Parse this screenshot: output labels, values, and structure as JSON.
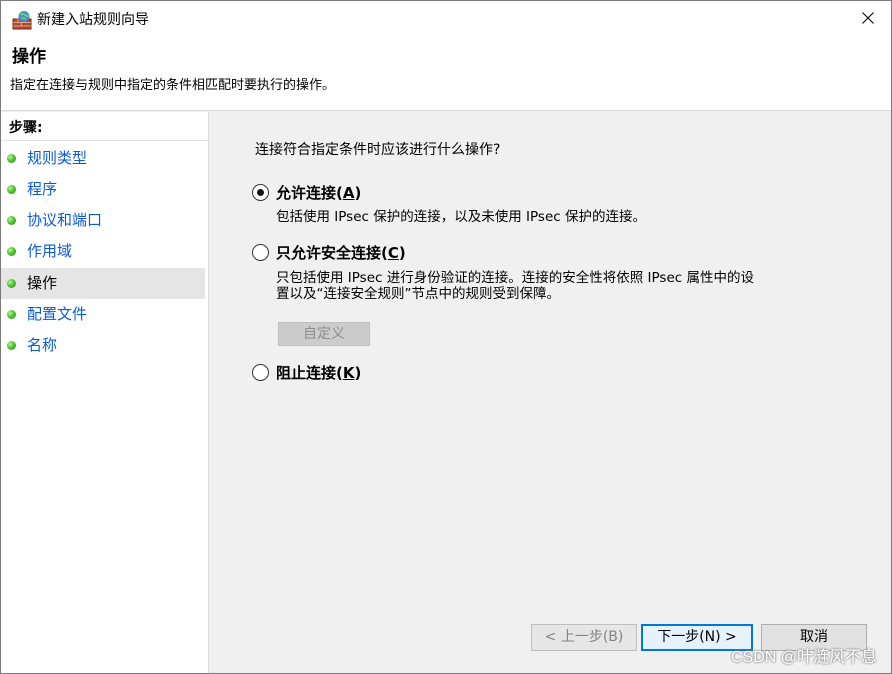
{
  "window": {
    "title": "新建入站规则向导"
  },
  "header": {
    "title": "操作",
    "subtitle": "指定在连接与规则中指定的条件相匹配时要执行的操作。"
  },
  "steps": {
    "heading": "步骤:",
    "items": [
      {
        "label": "规则类型"
      },
      {
        "label": "程序"
      },
      {
        "label": "协议和端口"
      },
      {
        "label": "作用域"
      },
      {
        "label": "操作"
      },
      {
        "label": "配置文件"
      },
      {
        "label": "名称"
      }
    ],
    "active_index": 4
  },
  "main": {
    "question": "连接符合指定条件时应该进行什么操作?",
    "options": [
      {
        "label_pre": "允许连接(",
        "accesskey": "A",
        "label_post": ")",
        "checked": true,
        "description": "包括使用 IPsec 保护的连接，以及未使用 IPsec 保护的连接。"
      },
      {
        "label_pre": "只允许安全连接(",
        "accesskey": "C",
        "label_post": ")",
        "checked": false,
        "description_line1": "只包括使用 IPsec 进行身份验证的连接。连接的安全性将依照 IPsec 属性中的设",
        "description_line2": "置以及“连接安全规则”节点中的规则受到保障。"
      },
      {
        "label_pre": "阻止连接(",
        "accesskey": "K",
        "label_post": ")",
        "checked": false
      }
    ],
    "custom_button": "自定义"
  },
  "footer": {
    "back_label": "< 上一步(B)",
    "next_label": "下一步(N) >",
    "cancel_label": "取消"
  },
  "watermark": "CSDN @叶涟风不息",
  "colors": {
    "step_link": "#0b5ad6",
    "active_step_bg": "#e5e5e5",
    "primary_border": "#0078d7"
  }
}
